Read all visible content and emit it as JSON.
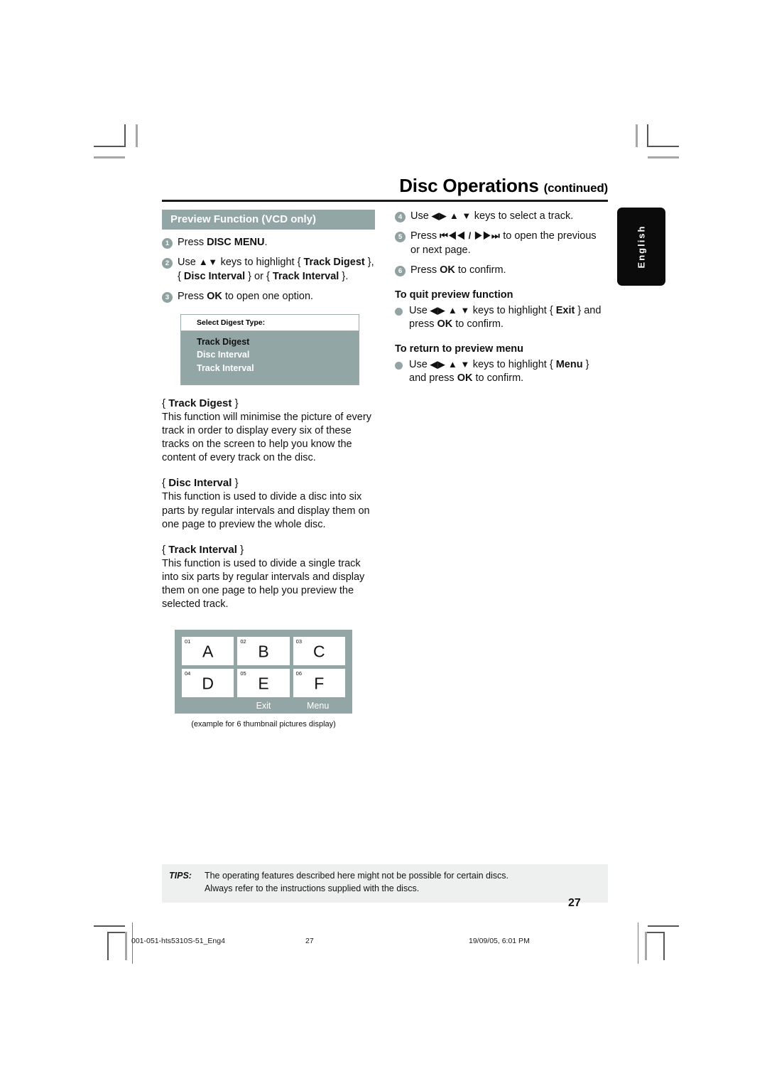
{
  "header": {
    "title": "Disc Operations",
    "continued": "(continued)"
  },
  "lang_tab": {
    "label": "English"
  },
  "left_column": {
    "section_heading": "Preview Function (VCD only)",
    "steps": [
      {
        "num": "1",
        "html": "Press <b>DISC MENU</b>."
      },
      {
        "num": "2",
        "html": "Use <span class=\"arrows b\">▲▼</span> keys to highlight { <b>Track Digest</b> },<br>{ <b>Disc Interval</b> } or { <b>Track Interval</b> }."
      },
      {
        "num": "3",
        "html": "Press <b>OK</b> to open one option."
      }
    ],
    "osd": {
      "header": "Select Digest Type:",
      "options": [
        {
          "label": "Track Digest",
          "selected": true
        },
        {
          "label": "Disc Interval",
          "selected": false
        },
        {
          "label": "Track Interval",
          "selected": false
        }
      ]
    },
    "definitions": [
      {
        "name": "Track Digest",
        "body": "This function will minimise the picture of every track in order to display every six of these tracks on the screen to help you know the content of every track on the disc."
      },
      {
        "name": "Disc Interval",
        "body": "This function is used to divide a disc into six parts by regular intervals and display them on one page to preview the whole disc."
      },
      {
        "name": "Track Interval",
        "body": "This function is used to divide a single track into six parts by regular intervals and display them on one page to help you preview the selected track."
      }
    ],
    "thumbnail_example": {
      "cells": [
        {
          "num": "01",
          "letter": "A"
        },
        {
          "num": "02",
          "letter": "B"
        },
        {
          "num": "03",
          "letter": "C"
        },
        {
          "num": "04",
          "letter": "D"
        },
        {
          "num": "05",
          "letter": "E"
        },
        {
          "num": "06",
          "letter": "F"
        }
      ],
      "exit_label": "Exit",
      "menu_label": "Menu",
      "caption": "(example for 6 thumbnail pictures display)"
    }
  },
  "right_column": {
    "steps": [
      {
        "num": "4",
        "html": "Use <span class=\"arrows b\">◀▶ ▲ ▼</span> keys to select a track."
      },
      {
        "num": "5",
        "html": "Press <span class=\"arrows b\">⏮◀◀ / ▶▶⏭</span> to open the previous or next page."
      },
      {
        "num": "6",
        "html": "Press <b>OK</b> to confirm."
      }
    ],
    "sub_sections": [
      {
        "heading": "To quit preview function",
        "bullet_html": "Use <span class=\"arrows b\">◀▶ ▲ ▼</span> keys to highlight { <b>Exit</b> } and press <b>OK</b> to confirm."
      },
      {
        "heading": "To return to preview menu",
        "bullet_html": "Use <span class=\"arrows b\">◀▶ ▲ ▼</span> keys to highlight { <b>Menu</b> } and press <b>OK</b> to confirm."
      }
    ]
  },
  "tips": {
    "label": "TIPS:",
    "line1": "The operating features described here might not be possible for certain discs.",
    "line2": "Always refer to the instructions supplied with the discs."
  },
  "page_number": "27",
  "print_footer": {
    "file": "001-051-hts5310S-51_Eng4",
    "page": "27",
    "date": "19/09/05, 6:01 PM"
  }
}
